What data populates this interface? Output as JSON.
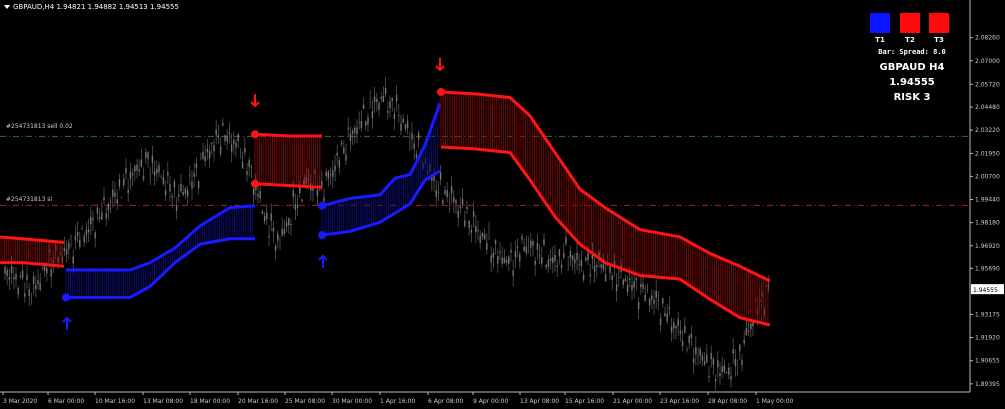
{
  "window": {
    "title": "GBPAUD,H4  1.94821 1.94882 1.94513 1.94555"
  },
  "hlines": [
    {
      "label": "#254731813 sell 0.02",
      "color": "#2a7a2a",
      "price": 2.0288
    },
    {
      "label": "#254731813 sl",
      "color": "#b81c1c",
      "price": 1.9912
    }
  ],
  "panel": {
    "boxes": [
      {
        "label": "T1",
        "color": "#0a14ff"
      },
      {
        "label": "T2",
        "color": "#ff0a0a"
      },
      {
        "label": "T3",
        "color": "#ff0a0a"
      }
    ],
    "bar_spread": "Bar:  Spread: 8.0",
    "symbol": "GBPAUD H4",
    "price": "1.94555",
    "risk": "RISK 3"
  },
  "chart_data": {
    "type": "line",
    "symbol": "GBPAUD",
    "timeframe": "H4",
    "ylim": [
      1.8895,
      2.0955
    ],
    "y_ticks": [
      "2.08260",
      "2.07000",
      "2.05720",
      "2.04480",
      "2.03220",
      "2.01950",
      "2.00700",
      "1.99440",
      "1.98180",
      "1.96920",
      "1.95690",
      "1.94555",
      "1.93175",
      "1.91920",
      "1.90655",
      "1.89395"
    ],
    "x_ticks": [
      "3 Mar 2020",
      "6 Mar 00:00",
      "10 Mar 16:00",
      "13 Mar 08:00",
      "18 Mar 00:00",
      "20 Mar 16:00",
      "25 Mar 08:00",
      "30 Mar 00:00",
      "1 Apr 16:00",
      "6 Apr 08:00",
      "9 Apr 00:00",
      "13 Apr 08:00",
      "15 Apr 16:00",
      "21 Apr 00:00",
      "23 Apr 16:00",
      "28 Apr 08:00",
      "1 May 00:00"
    ],
    "current_price": 1.94555,
    "price_series": [
      1.955,
      1.95,
      1.945,
      1.96,
      1.965,
      1.972,
      1.98,
      1.99,
      2.0,
      2.01,
      2.015,
      2.005,
      1.995,
      2.005,
      2.02,
      2.03,
      2.025,
      2.01,
      1.985,
      1.97,
      1.99,
      2.005,
      2.0,
      2.015,
      2.03,
      2.04,
      2.05,
      2.045,
      2.03,
      2.015,
      2.0,
      1.995,
      1.985,
      1.975,
      1.965,
      1.96,
      1.97,
      1.965,
      1.96,
      1.965,
      1.958,
      1.96,
      1.955,
      1.95,
      1.945,
      1.94,
      1.93,
      1.92,
      1.91,
      1.903,
      1.9,
      1.91,
      1.935,
      1.946
    ],
    "series": [
      {
        "name": "Buy band upper",
        "color": "#1a1aff",
        "values": [
          1.956,
          1.956,
          1.956,
          1.956,
          1.96,
          1.968,
          1.98,
          1.99,
          1.991,
          1.991,
          1.995,
          1.997,
          2.006,
          2.008,
          2.013,
          2.024,
          2.047,
          2.048
        ]
      },
      {
        "name": "Buy band lower",
        "color": "#1a1aff",
        "values": [
          1.941,
          1.941,
          1.941,
          1.941,
          1.947,
          1.96,
          1.97,
          1.973,
          1.973,
          1.975,
          1.977,
          1.982,
          1.987,
          1.992,
          1.996,
          2.005,
          2.01,
          2.009
        ]
      },
      {
        "name": "Sell band upper",
        "color": "#ff1414",
        "values": [
          1.974,
          1.973,
          1.972,
          1.971,
          2.03,
          2.029,
          2.029,
          2.053,
          2.052,
          2.05,
          2.04,
          2.02,
          2.0,
          1.99,
          1.978,
          1.976,
          1.974,
          1.972,
          1.965,
          1.958,
          1.95
        ]
      },
      {
        "name": "Sell band lower",
        "color": "#ff1414",
        "values": [
          1.96,
          1.96,
          1.959,
          1.958,
          2.003,
          2.002,
          2.001,
          2.023,
          2.022,
          2.02,
          2.005,
          1.985,
          1.97,
          1.96,
          1.953,
          1.952,
          1.951,
          1.949,
          1.94,
          1.93,
          1.926
        ]
      }
    ],
    "signals": [
      {
        "type": "buy",
        "price": 1.941
      },
      {
        "type": "sell",
        "price": 2.03
      },
      {
        "type": "buy",
        "price": 1.968
      },
      {
        "type": "sell",
        "price": 2.053
      }
    ]
  }
}
